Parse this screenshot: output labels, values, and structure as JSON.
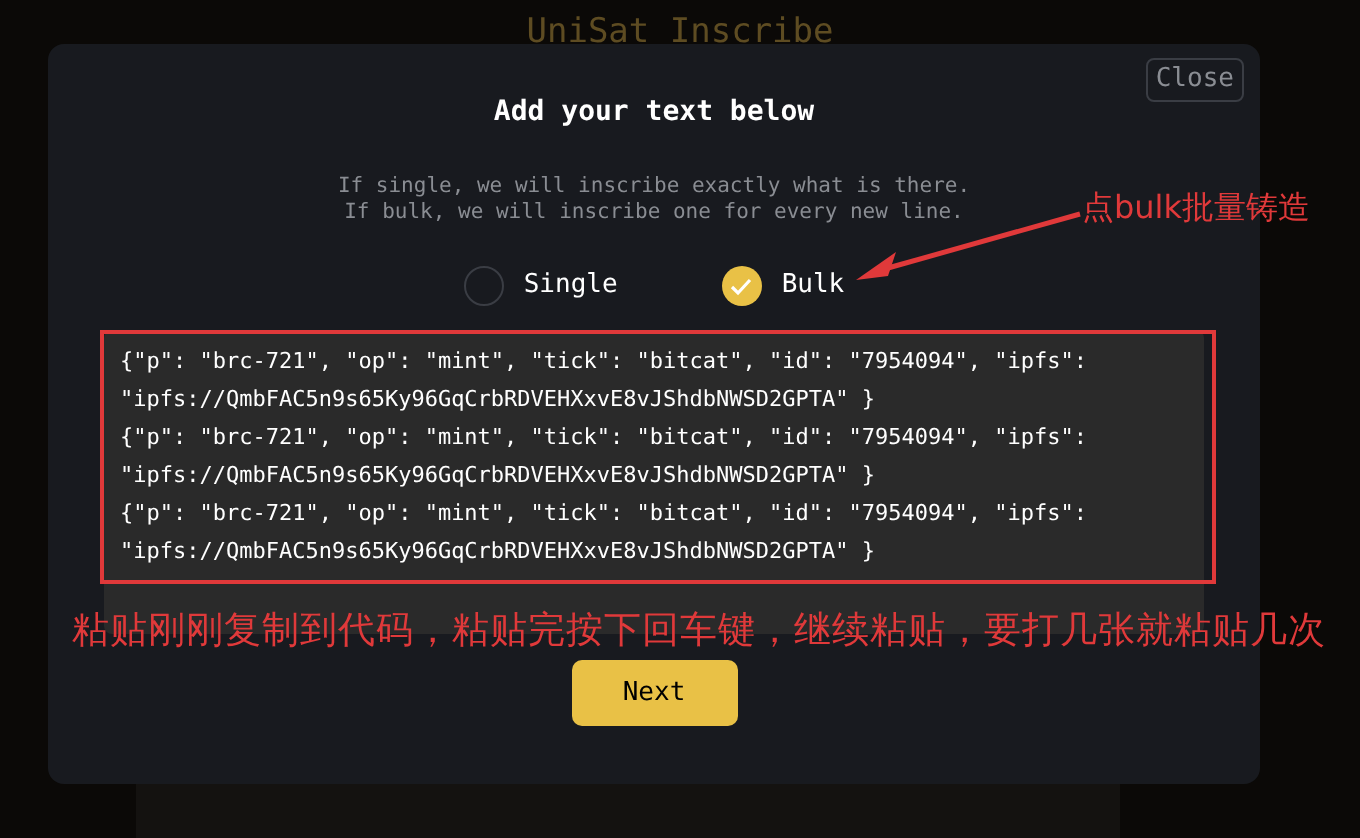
{
  "page": {
    "title": "UniSat Inscribe"
  },
  "dialog": {
    "close": "Close",
    "title": "Add your text below",
    "description": [
      "If single, we will inscribe exactly what is there.",
      "If bulk, we will inscribe one for every new line."
    ],
    "options": [
      {
        "label": "Single",
        "selected": false
      },
      {
        "label": "Bulk",
        "selected": true
      }
    ],
    "text_lines": [
      "{\"p\": \"brc-721\", \"op\": \"mint\", \"tick\": \"bitcat\", \"id\": \"7954094\", \"ipfs\": \"ipfs://QmbFAC5n9s65Ky96GqCrbRDVEHXxvE8vJShdbNWSD2GPTA\" }",
      "{\"p\": \"brc-721\", \"op\": \"mint\", \"tick\": \"bitcat\", \"id\": \"7954094\", \"ipfs\": \"ipfs://QmbFAC5n9s65Ky96GqCrbRDVEHXxvE8vJShdbNWSD2GPTA\" }",
      "{\"p\": \"brc-721\", \"op\": \"mint\", \"tick\": \"bitcat\", \"id\": \"7954094\", \"ipfs\": \"ipfs://QmbFAC5n9s65Ky96GqCrbRDVEHXxvE8vJShdbNWSD2GPTA\" }"
    ],
    "button": "Next"
  },
  "annotations": [
    {
      "kind": "arrow_note",
      "text": "点bulk批量铸造"
    },
    {
      "kind": "frame_note",
      "text": "粘贴刚刚复制到代码，粘贴完按下回车键，继续粘贴，要打几张就粘贴几次"
    }
  ]
}
